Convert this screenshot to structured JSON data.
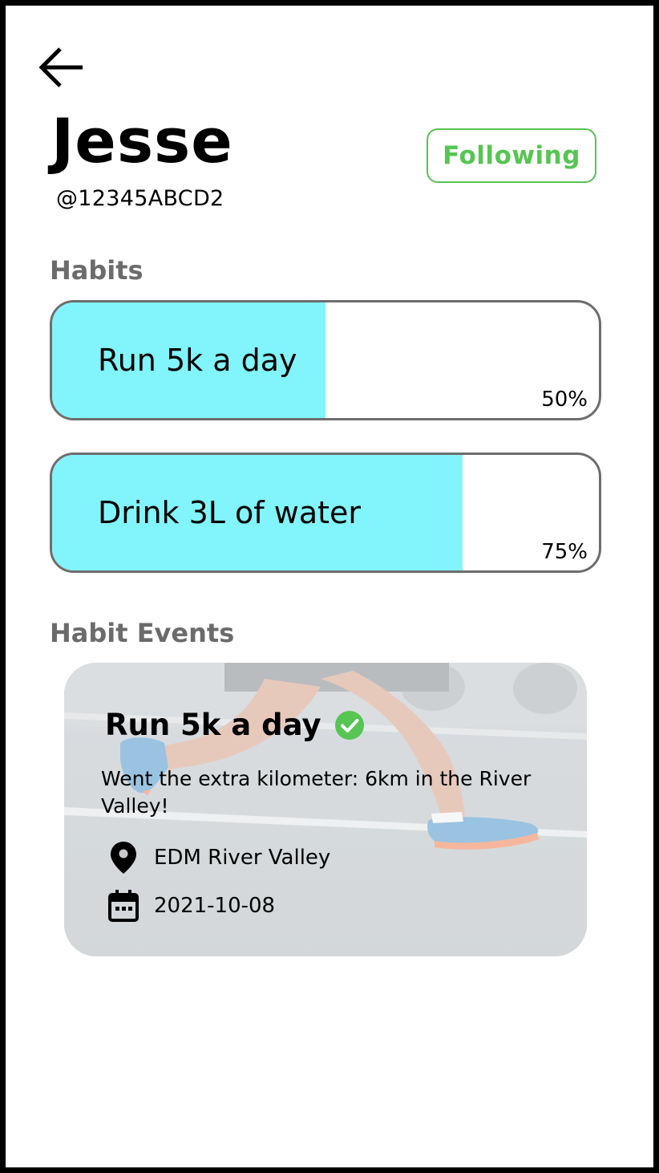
{
  "header": {
    "back_icon": "arrow-left-icon"
  },
  "profile": {
    "name": "Jesse",
    "handle": "@12345ABCD2",
    "follow_label": "Following"
  },
  "colors": {
    "progress_fill": "#82f4fb",
    "follow_green": "#56c552",
    "section_gray": "#6b6b6b"
  },
  "habits": {
    "title": "Habits",
    "items": [
      {
        "label": "Run 5k a day",
        "progress_text": "50%",
        "progress": 0.5
      },
      {
        "label": "Drink 3L of water",
        "progress_text": "75%",
        "progress": 0.75
      }
    ]
  },
  "events": {
    "title": "Habit Events",
    "items": [
      {
        "habit": "Run 5k a day",
        "status_icon": "check-circle-icon",
        "comment": "Went the extra kilometer: 6km in the River Valley!",
        "location_icon": "location-pin-icon",
        "location": "EDM River Valley",
        "date_icon": "calendar-icon",
        "date": "2021-10-08",
        "image": "runner-photo"
      }
    ]
  }
}
